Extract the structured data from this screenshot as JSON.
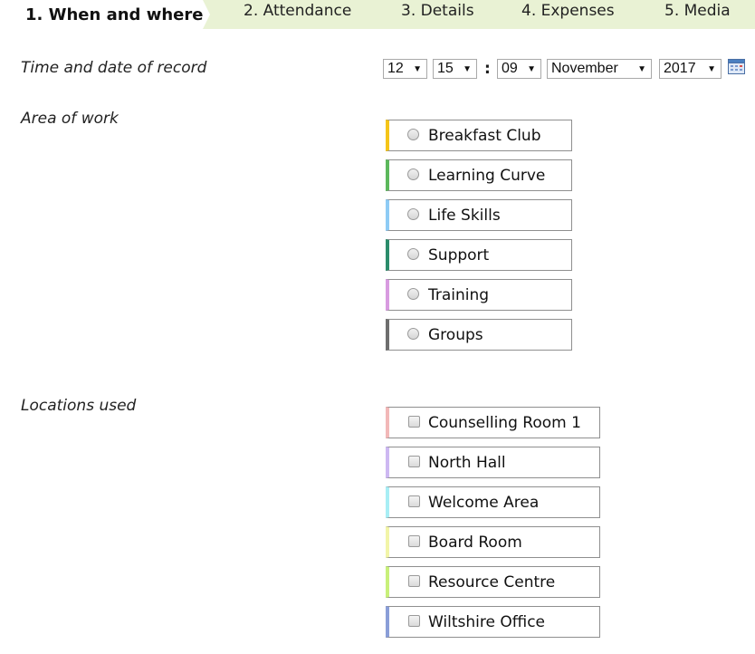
{
  "tabs": [
    {
      "label": "1. When and where"
    },
    {
      "label": "2. Attendance"
    },
    {
      "label": "3. Details"
    },
    {
      "label": "4. Expenses"
    },
    {
      "label": "5. Media"
    }
  ],
  "time_date": {
    "label": "Time and date of record",
    "hour": "12",
    "minute": "15",
    "colon": ":",
    "day": "09",
    "month": "November",
    "year": "2017",
    "calendar_icon": "calendar-icon"
  },
  "area_of_work": {
    "label": "Area of work",
    "options": [
      {
        "label": "Breakfast Club",
        "color": "#f5c518"
      },
      {
        "label": "Learning Curve",
        "color": "#5cb85c"
      },
      {
        "label": "Life Skills",
        "color": "#8ecbf5"
      },
      {
        "label": "Support",
        "color": "#2b8c6b"
      },
      {
        "label": "Training",
        "color": "#d89be0"
      },
      {
        "label": "Groups",
        "color": "#6e6e6e"
      }
    ]
  },
  "locations": {
    "label": "Locations used",
    "options": [
      {
        "label": "Counselling Room 1",
        "color": "#f2b8b8"
      },
      {
        "label": "North Hall",
        "color": "#cdb8f2"
      },
      {
        "label": "Welcome Area",
        "color": "#a8eef5"
      },
      {
        "label": "Board Room",
        "color": "#f2f5a8"
      },
      {
        "label": "Resource Centre",
        "color": "#c8f07a"
      },
      {
        "label": "Wiltshire Office",
        "color": "#8a9ed8"
      }
    ]
  }
}
